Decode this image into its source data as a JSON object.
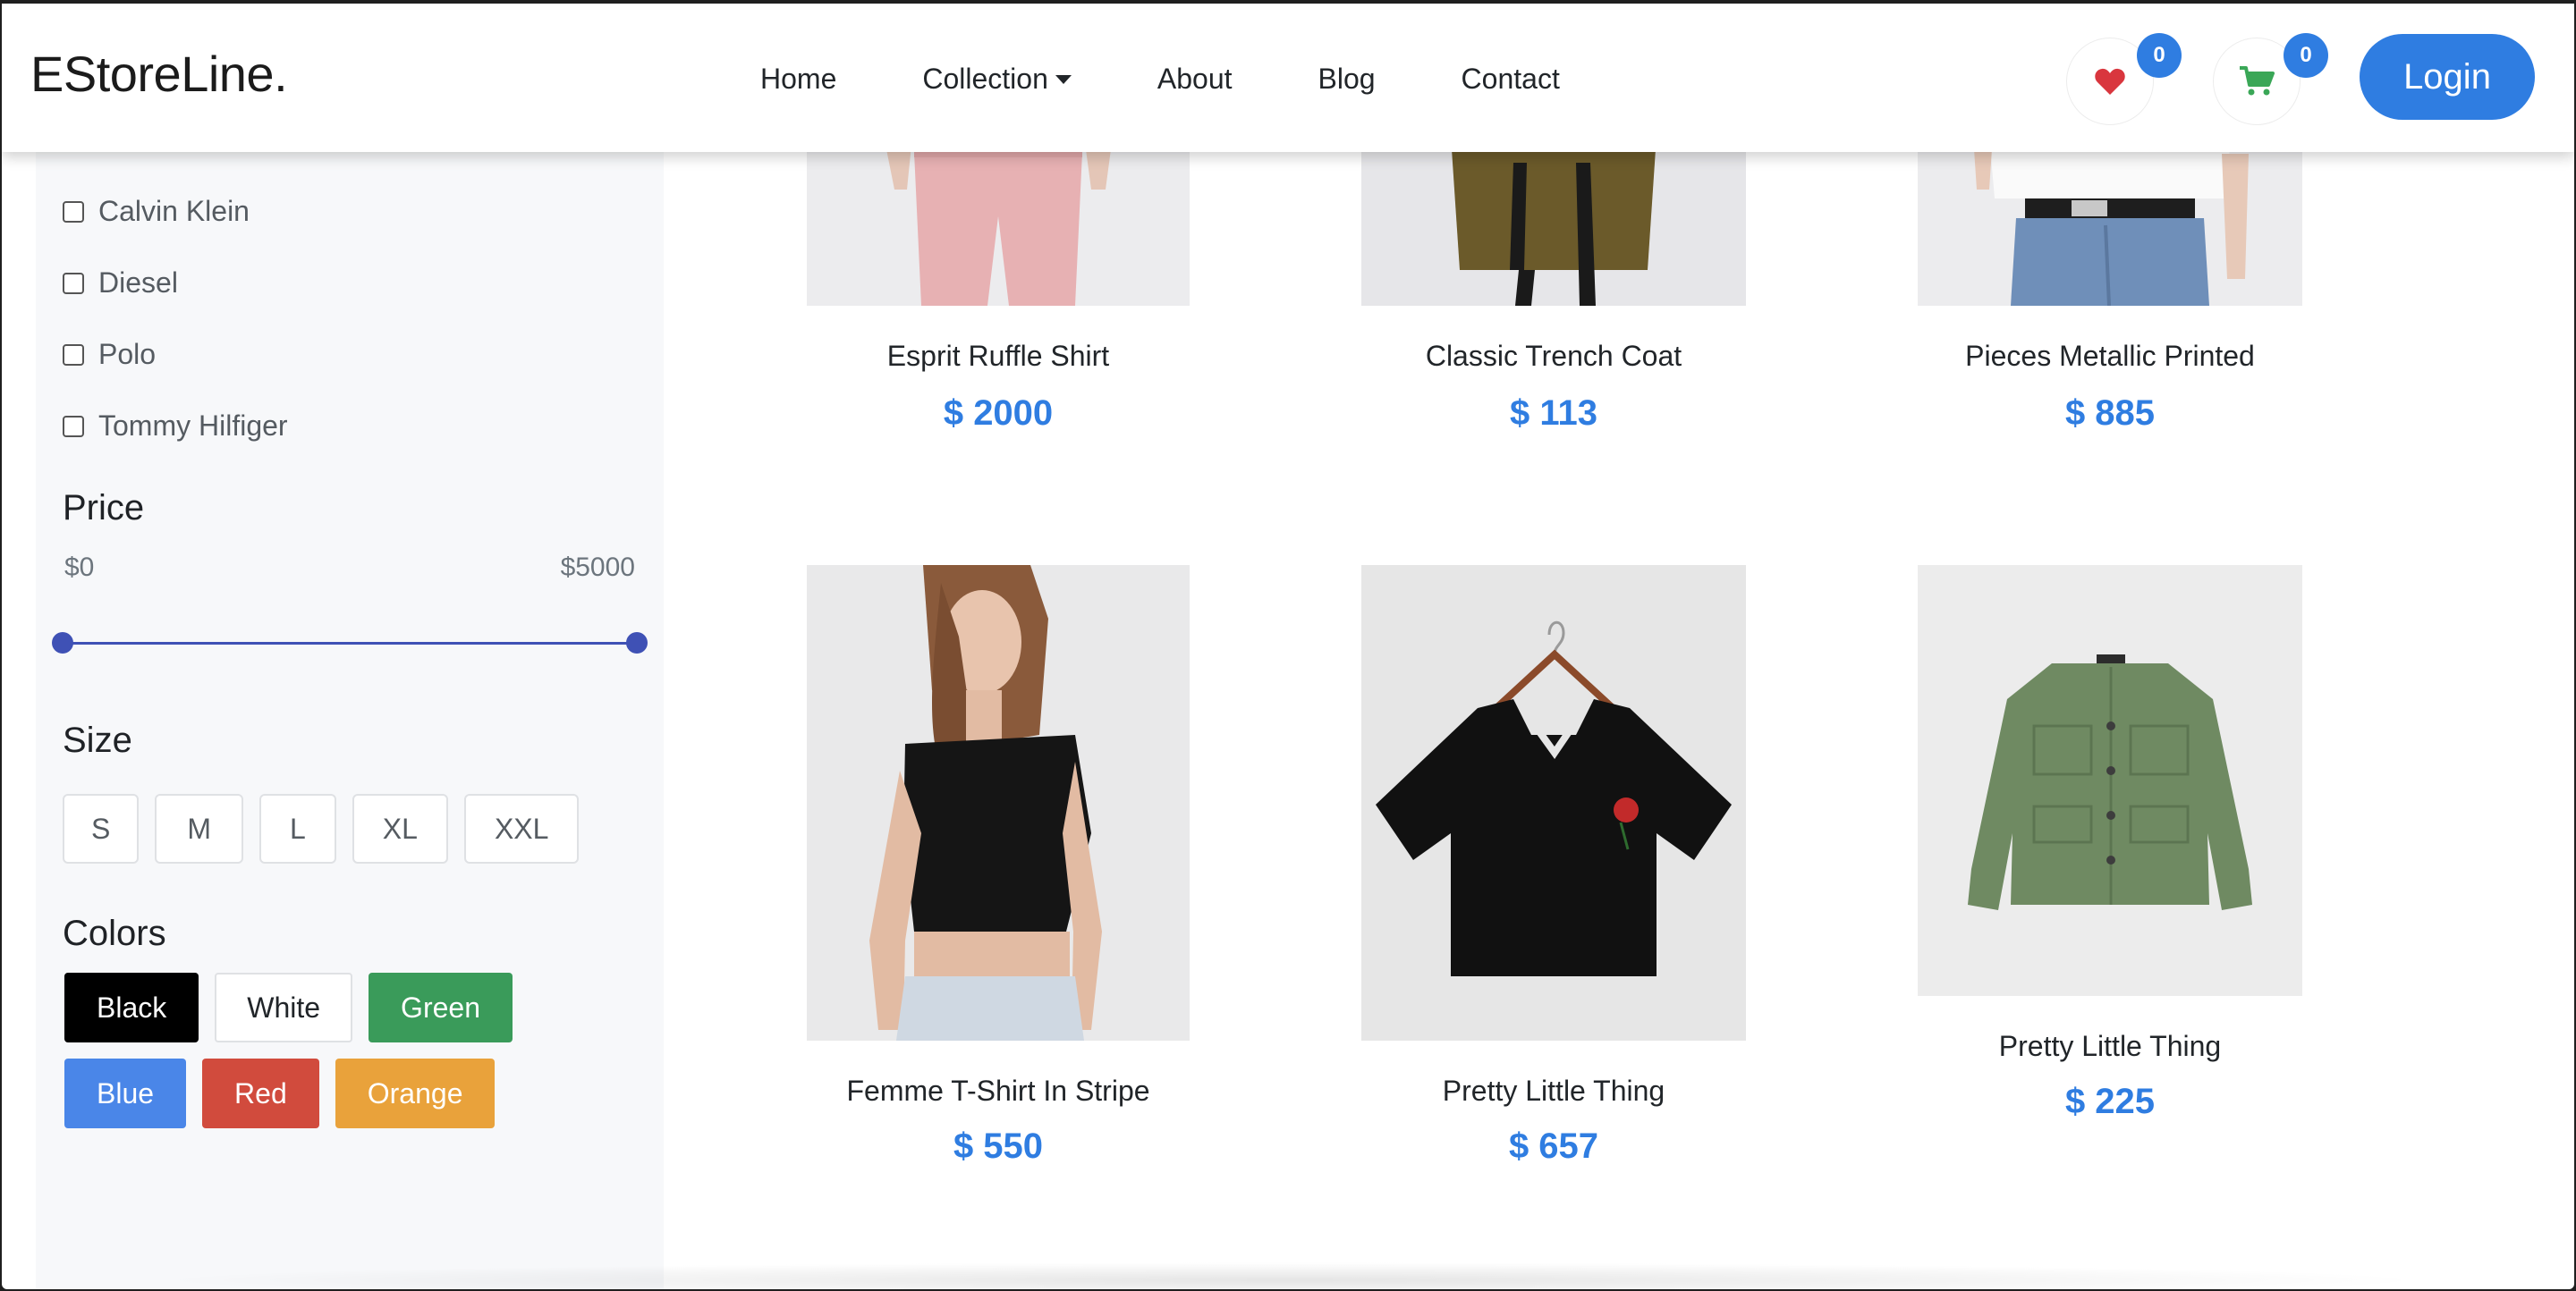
{
  "brand": "EStoreLine.",
  "nav": {
    "home": "Home",
    "collection": "Collection",
    "about": "About",
    "blog": "Blog",
    "contact": "Contact"
  },
  "wishlist": {
    "icon": "heart-icon",
    "count": "0",
    "color": "#d9363e"
  },
  "cart": {
    "icon": "cart-icon",
    "count": "0",
    "color": "#3aa757"
  },
  "login_label": "Login",
  "filters": {
    "brands": [
      {
        "label": "Calvin Klein",
        "checked": false
      },
      {
        "label": "Diesel",
        "checked": false
      },
      {
        "label": "Polo",
        "checked": false
      },
      {
        "label": "Tommy Hilfiger",
        "checked": false
      }
    ],
    "price": {
      "title": "Price",
      "min_label": "$0",
      "max_label": "$5000",
      "min": 0,
      "max": 5000
    },
    "size": {
      "title": "Size",
      "options": [
        "S",
        "M",
        "L",
        "XL",
        "XXL"
      ]
    },
    "colors": {
      "title": "Colors",
      "options": [
        {
          "label": "Black",
          "bg": "#000000",
          "fg": "#ffffff"
        },
        {
          "label": "White",
          "bg": "#ffffff",
          "fg": "#212529"
        },
        {
          "label": "Green",
          "bg": "#3a9b5a",
          "fg": "#ffffff"
        },
        {
          "label": "Blue",
          "bg": "#4a86e8",
          "fg": "#ffffff"
        },
        {
          "label": "Red",
          "bg": "#d14b3d",
          "fg": "#ffffff"
        },
        {
          "label": "Orange",
          "bg": "#e9a23b",
          "fg": "#ffffff"
        }
      ]
    }
  },
  "products": [
    {
      "name": "Esprit Ruffle Shirt",
      "price": "$ 2000"
    },
    {
      "name": "Classic Trench Coat",
      "price": "$ 113"
    },
    {
      "name": "Pieces Metallic Printed",
      "price": "$ 885"
    },
    {
      "name": "Femme T-Shirt In Stripe",
      "price": "$ 550"
    },
    {
      "name": "Pretty Little Thing",
      "price": "$ 657"
    },
    {
      "name": "Pretty Little Thing",
      "price": "$ 225"
    }
  ],
  "accent_color": "#2f7de1"
}
